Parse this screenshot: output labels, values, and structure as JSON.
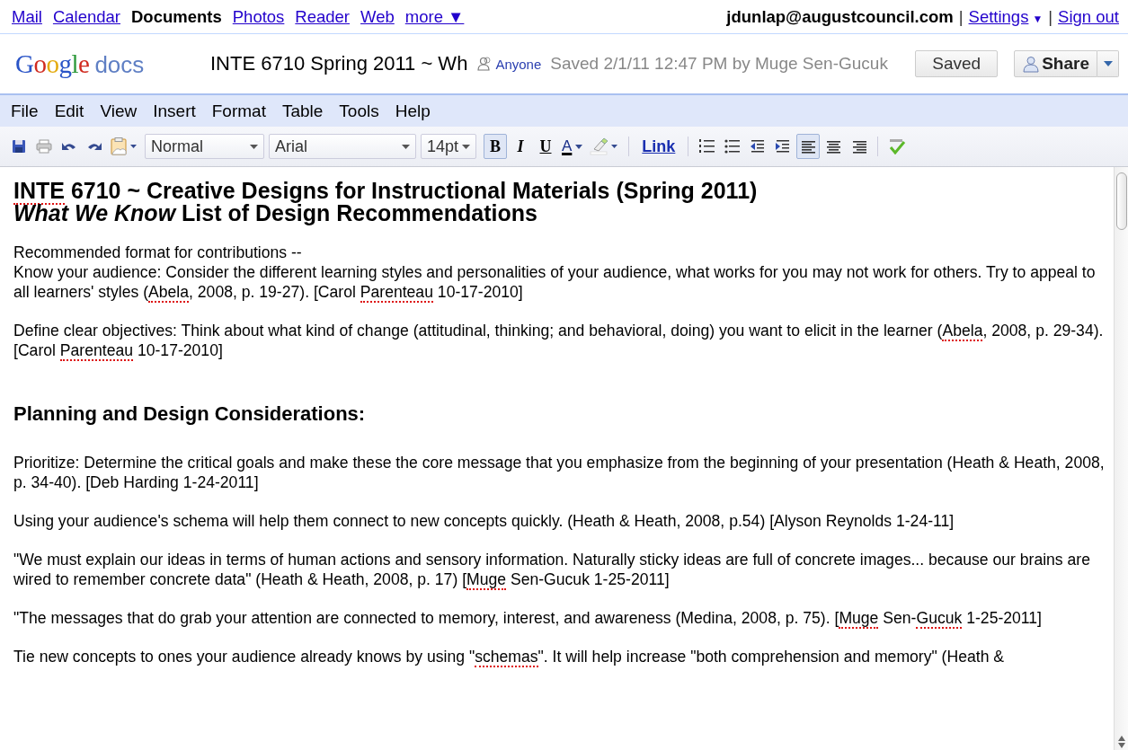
{
  "topbar": {
    "nav": [
      {
        "label": "Mail",
        "selected": false
      },
      {
        "label": "Calendar",
        "selected": false
      },
      {
        "label": "Documents",
        "selected": true
      },
      {
        "label": "Photos",
        "selected": false
      },
      {
        "label": "Reader",
        "selected": false
      },
      {
        "label": "Web",
        "selected": false
      },
      {
        "label": "more ▼",
        "selected": false
      }
    ],
    "account": {
      "email": "jdunlap@augustcouncil.com",
      "separator_1": "|",
      "settings": "Settings",
      "settings_caret": "▼",
      "separator_2": "|",
      "sign_out": "Sign out"
    }
  },
  "header": {
    "logo": {
      "word_1": "Google",
      "word_2": "docs"
    },
    "document_title": "INTE 6710 Spring 2011 ~ Wh",
    "sharing": "Anyone",
    "save_status": "Saved 2/1/11 12:47 PM by Muge Sen-Gucuk",
    "saved_button": "Saved",
    "share_button": "Share"
  },
  "menu": [
    "File",
    "Edit",
    "View",
    "Insert",
    "Format",
    "Table",
    "Tools",
    "Help"
  ],
  "toolbar": {
    "style_select": "Normal",
    "font_select": "Arial",
    "size_select": "14pt",
    "format_buttons": [
      {
        "label": "B",
        "selected": true
      },
      {
        "label": "I",
        "selected": false
      },
      {
        "label": "U",
        "selected": false
      }
    ],
    "text_color_button": "A",
    "link_button": "Link",
    "align_buttons": [
      {
        "selected": true
      },
      {
        "selected": false
      },
      {
        "selected": false
      }
    ]
  },
  "document": {
    "blocks": [
      {
        "kind": "title",
        "segments": [
          {
            "text": "INTE",
            "misspelled": true
          },
          {
            "text": " 6710 ~ Creative Designs for Instructional Materials (Spring 2011)",
            "misspelled": false
          }
        ]
      },
      {
        "kind": "title",
        "segments": [
          {
            "text": "*What We Know* List of Design Recommendations",
            "misspelled": false
          }
        ]
      },
      {
        "kind": "lead",
        "segments": [
          {
            "text": "Recommended format for contributions --",
            "misspelled": false
          }
        ]
      },
      {
        "kind": "paragraph",
        "segments": [
          {
            "text": "Know your audience: Consider the different learning styles and personalities of your audience, what works for you may not work for others. Try to appeal to all learners' styles (",
            "misspelled": false
          },
          {
            "text": "Abela",
            "misspelled": true
          },
          {
            "text": ", 2008, p. 19-27). [Carol ",
            "misspelled": false
          },
          {
            "text": "Parenteau",
            "misspelled": true
          },
          {
            "text": " 10-17-2010]",
            "misspelled": false
          }
        ]
      },
      {
        "kind": "paragraph",
        "segments": [
          {
            "text": "Define clear objectives: Think about what kind of change (attitudinal, thinking; and behavioral, doing) you want to elicit in the learner (",
            "misspelled": false
          },
          {
            "text": "Abela",
            "misspelled": true
          },
          {
            "text": ", 2008, p. 29-34). [Carol ",
            "misspelled": false
          },
          {
            "text": "Parenteau",
            "misspelled": true
          },
          {
            "text": " 10-17-2010]",
            "misspelled": false
          }
        ]
      },
      {
        "kind": "heading",
        "segments": [
          {
            "text": "Planning and Design Considerations:",
            "misspelled": false
          }
        ]
      },
      {
        "kind": "paragraph",
        "segments": [
          {
            "text": "Prioritize: Determine the critical goals and make these the core message that you emphasize from the beginning of your presentation (Heath & Heath, 2008, p. 34-40). [Deb Harding 1-24-2011]",
            "misspelled": false
          }
        ]
      },
      {
        "kind": "paragraph",
        "segments": [
          {
            "text": "Using your audience's schema will help them connect to new concepts quickly. (Heath & Heath, 2008, p.54) [Alyson Reynolds 1-24-11]",
            "misspelled": false
          }
        ]
      },
      {
        "kind": "paragraph",
        "segments": [
          {
            "text": "\"We must explain our ideas in terms of human actions and sensory information. Naturally sticky ideas are full of concrete images... because our brains are wired to remember concrete data\" (Heath & Heath, 2008, p. 17) [",
            "misspelled": false
          },
          {
            "text": "Muge",
            "misspelled": true
          },
          {
            "text": " Sen-Gucuk 1-25-2011]",
            "misspelled": false
          }
        ]
      },
      {
        "kind": "paragraph",
        "segments": [
          {
            "text": "\"The messages that do grab your attention are connected to memory, interest, and awareness (Medina, 2008, p. 75). [",
            "misspelled": false
          },
          {
            "text": "Muge",
            "misspelled": true
          },
          {
            "text": " Sen-",
            "misspelled": false
          },
          {
            "text": "Gucuk",
            "misspelled": true
          },
          {
            "text": " 1-25-2011]",
            "misspelled": false
          }
        ]
      },
      {
        "kind": "paragraph",
        "segments": [
          {
            "text": "Tie new concepts to ones your audience already knows by using \"",
            "misspelled": false
          },
          {
            "text": "schemas",
            "misspelled": true
          },
          {
            "text": "\". It will help increase \"both comprehension and memory\" (Heath &",
            "misspelled": false
          }
        ]
      }
    ]
  }
}
